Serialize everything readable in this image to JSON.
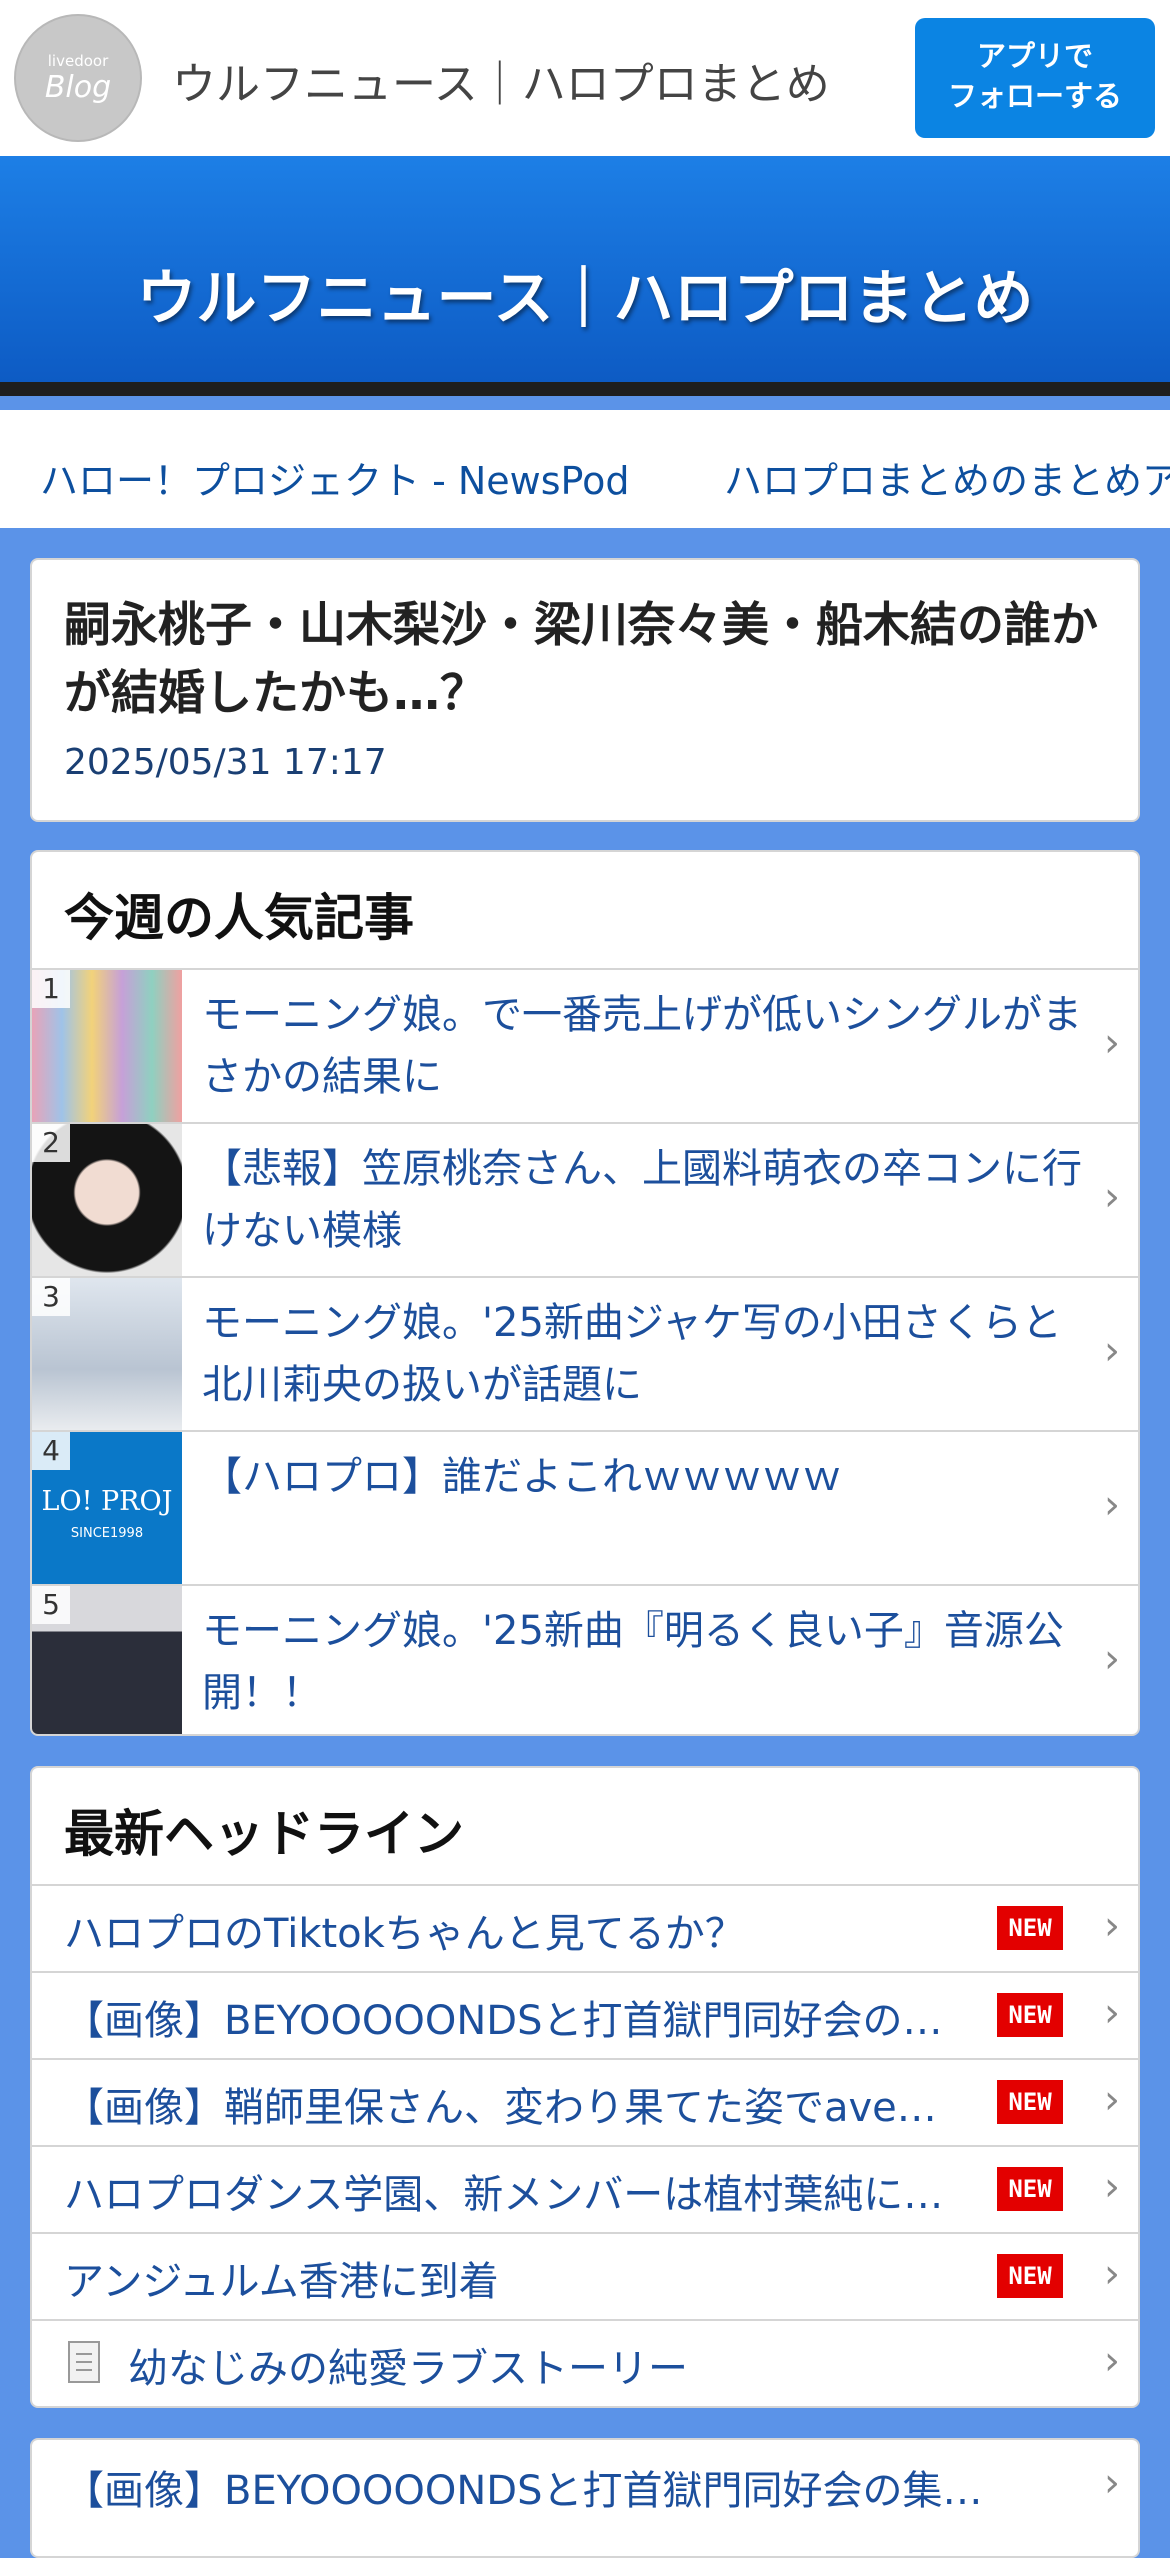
{
  "header": {
    "logo_small": "livedoor",
    "logo_big": "Blog",
    "site_name": "ウルフニュース｜ハロプロまとめ",
    "follow_line1": "アプリで",
    "follow_line2": "フォローする"
  },
  "hero": {
    "title": "ウルフニュース｜ハロプロまとめ"
  },
  "nav": {
    "links": [
      "ハロー！プロジェクト - NewsPod",
      "ハロプロまとめのまとめア"
    ]
  },
  "article": {
    "title": "嗣永桃子・山木梨沙・梁川奈々美・船木結の誰かが結婚したかも…？",
    "date": "2025/05/31 17:17"
  },
  "popular": {
    "heading": "今週の人気記事",
    "items": [
      {
        "rank": "1",
        "title": "モーニング娘。で一番売上げが低いシングルがまさかの結果に"
      },
      {
        "rank": "2",
        "title": "【悲報】笠原桃奈さん、上國料萌衣の卒コンに行けない模様"
      },
      {
        "rank": "3",
        "title": "モーニング娘。'25新曲ジャケ写の小田さくらと北川莉央の扱いが話題に"
      },
      {
        "rank": "4",
        "title": "【ハロプロ】誰だよこれｗｗｗｗｗ",
        "thumb_text": "LO! PROJ",
        "thumb_sub": "SINCE1998"
      },
      {
        "rank": "5",
        "title": "モーニング娘。'25新曲『明るく良い子』音源公開！！"
      }
    ]
  },
  "headlines": {
    "heading": "最新ヘッドライン",
    "items": [
      {
        "title": "ハロプロのTiktokちゃんと見てるか？",
        "badge": "NEW"
      },
      {
        "title": "【画像】BEYOOOOONDSと打首獄門同好会の…",
        "badge": "NEW"
      },
      {
        "title": "【画像】鞘師里保さん、変わり果てた姿でave…",
        "badge": "NEW"
      },
      {
        "title": "ハロプロダンス学園、新メンバーは植村葉純に…",
        "badge": "NEW"
      },
      {
        "title": "アンジュルム香港に到着",
        "badge": "NEW"
      },
      {
        "title": "幼なじみの純愛ラブストーリー",
        "badge": ""
      }
    ]
  },
  "related": {
    "title": "【画像】BEYOOOOONDSと打首獄門同好会の集…"
  },
  "icons": {
    "chevron": "chevron-right-icon",
    "document": "document-icon"
  },
  "colors": {
    "accent": "#0b84e3",
    "link": "#1c4f9c",
    "new_badge": "#e30000",
    "background": "#5b93e8"
  }
}
